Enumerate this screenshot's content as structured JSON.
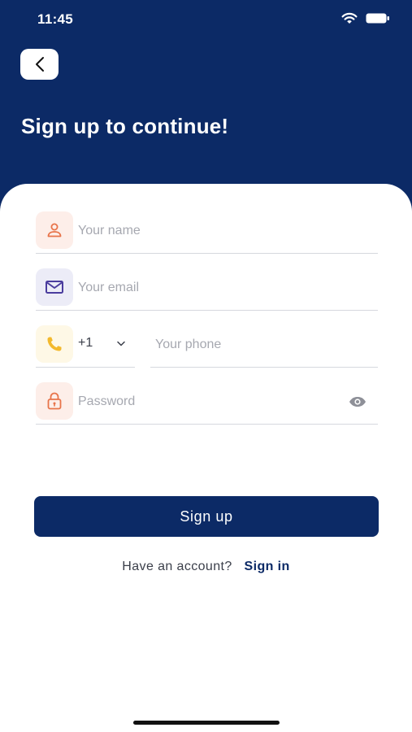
{
  "status_bar": {
    "time": "11:45"
  },
  "header": {
    "title": "Sign up to continue!"
  },
  "form": {
    "name": {
      "placeholder": "Your name",
      "value": ""
    },
    "email": {
      "placeholder": "Your email",
      "value": ""
    },
    "phone": {
      "country_code": "+1",
      "placeholder": "Your phone",
      "value": ""
    },
    "password": {
      "placeholder": "Password",
      "value": ""
    }
  },
  "actions": {
    "signup_label": "Sign up",
    "signin_prompt": "Have an account?",
    "signin_link": "Sign in"
  },
  "icons": {
    "back": "chevron-left-icon",
    "name": "user-icon",
    "email": "mail-icon",
    "phone": "phone-icon",
    "password": "lock-icon",
    "visibility": "eye-icon"
  },
  "colors": {
    "brand": "#0c2a66",
    "user_tile": "#fdeee9",
    "user_icon": "#e8744a",
    "mail_tile": "#ececf7",
    "mail_icon": "#4a3c9e",
    "phone_tile": "#fef8e6",
    "phone_icon": "#f3b92c",
    "lock_tile": "#fdeee9",
    "lock_icon": "#e8744a"
  }
}
